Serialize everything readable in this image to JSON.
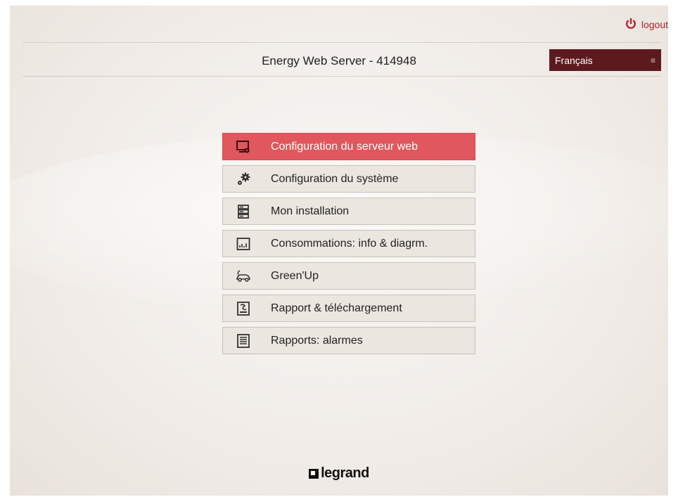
{
  "header": {
    "logout_label": "logout",
    "title": "Energy Web Server - 414948",
    "language": "Français"
  },
  "menu": {
    "items": [
      {
        "label": "Configuration du serveur web",
        "icon": "monitor-gear-icon",
        "active": true
      },
      {
        "label": "Configuration du système",
        "icon": "gears-icon",
        "active": false
      },
      {
        "label": "Mon installation",
        "icon": "server-stack-icon",
        "active": false
      },
      {
        "label": "Consommations: info & diagrm.",
        "icon": "bar-chart-icon",
        "active": false
      },
      {
        "label": "Green'Up",
        "icon": "electric-car-icon",
        "active": false
      },
      {
        "label": "Rapport & téléchargement",
        "icon": "report-download-icon",
        "active": false
      },
      {
        "label": "Rapports: alarmes",
        "icon": "alarm-report-icon",
        "active": false
      }
    ]
  },
  "footer": {
    "brand": "legrand"
  },
  "colors": {
    "accent": "#b5202b",
    "active_item": "#e0585d",
    "language_bg": "#5c1a1e"
  }
}
